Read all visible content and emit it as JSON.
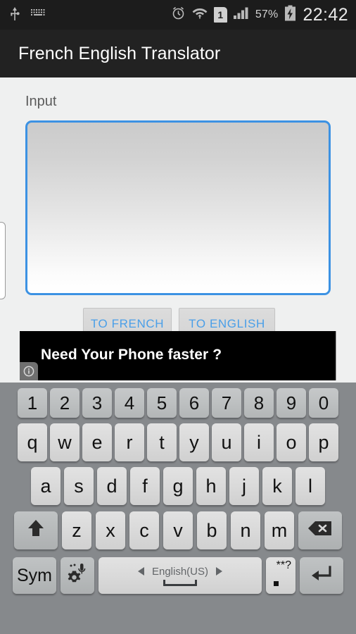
{
  "statusbar": {
    "left_icons": [
      "usb-icon",
      "keyboard-icon"
    ],
    "right_icons": [
      "alarm-icon",
      "wifi-icon",
      "sim-icon",
      "signal-icon",
      "battery-charging-icon"
    ],
    "sim_label": "1",
    "battery_percent": "57%",
    "clock": "22:42"
  },
  "titlebar": {
    "title": "French English Translator"
  },
  "app": {
    "input_label": "Input",
    "input_value": "",
    "input_placeholder": "",
    "buttons": [
      {
        "label": "TO FRENCH",
        "name": "to-french-button"
      },
      {
        "label": "TO ENGLISH",
        "name": "to-english-button"
      }
    ]
  },
  "ad": {
    "headline": "Need Your Phone faster ?",
    "info_icon": "info-icon"
  },
  "keyboard": {
    "row_numbers": [
      "1",
      "2",
      "3",
      "4",
      "5",
      "6",
      "7",
      "8",
      "9",
      "0"
    ],
    "row_top": [
      "q",
      "w",
      "e",
      "r",
      "t",
      "y",
      "u",
      "i",
      "o",
      "p"
    ],
    "row_home": [
      "a",
      "s",
      "d",
      "f",
      "g",
      "h",
      "j",
      "k",
      "l"
    ],
    "row_bottom": [
      "z",
      "x",
      "c",
      "v",
      "b",
      "n",
      "m"
    ],
    "shift_key": "shift-icon",
    "backspace_key": "backspace-icon",
    "sym_key": "Sym",
    "settings_key": "gear-mic-icon",
    "space_language": "English(US)",
    "space_key": "space-icon",
    "period_key_top": "**?",
    "period_key_main": ".",
    "enter_key": "enter-icon"
  },
  "colors": {
    "accent_blue": "#3c92e3",
    "button_text_blue": "#4a9fe8",
    "titlebar_bg": "#222222",
    "statusbar_bg": "#1c1c1c",
    "app_bg": "#eff0f0",
    "keyboard_bg": "#86898c",
    "ad_bg": "#000000"
  }
}
